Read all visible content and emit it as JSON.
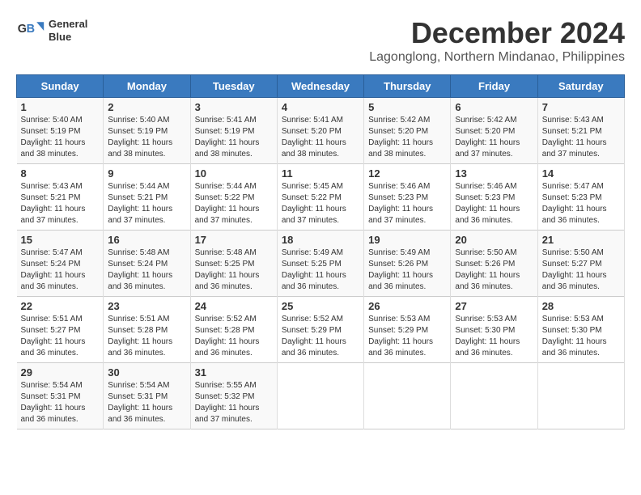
{
  "header": {
    "logo_line1": "General",
    "logo_line2": "Blue",
    "month": "December 2024",
    "location": "Lagonglong, Northern Mindanao, Philippines"
  },
  "weekdays": [
    "Sunday",
    "Monday",
    "Tuesday",
    "Wednesday",
    "Thursday",
    "Friday",
    "Saturday"
  ],
  "weeks": [
    [
      {
        "day": "1",
        "detail": "Sunrise: 5:40 AM\nSunset: 5:19 PM\nDaylight: 11 hours\nand 38 minutes."
      },
      {
        "day": "2",
        "detail": "Sunrise: 5:40 AM\nSunset: 5:19 PM\nDaylight: 11 hours\nand 38 minutes."
      },
      {
        "day": "3",
        "detail": "Sunrise: 5:41 AM\nSunset: 5:19 PM\nDaylight: 11 hours\nand 38 minutes."
      },
      {
        "day": "4",
        "detail": "Sunrise: 5:41 AM\nSunset: 5:20 PM\nDaylight: 11 hours\nand 38 minutes."
      },
      {
        "day": "5",
        "detail": "Sunrise: 5:42 AM\nSunset: 5:20 PM\nDaylight: 11 hours\nand 38 minutes."
      },
      {
        "day": "6",
        "detail": "Sunrise: 5:42 AM\nSunset: 5:20 PM\nDaylight: 11 hours\nand 37 minutes."
      },
      {
        "day": "7",
        "detail": "Sunrise: 5:43 AM\nSunset: 5:21 PM\nDaylight: 11 hours\nand 37 minutes."
      }
    ],
    [
      {
        "day": "8",
        "detail": "Sunrise: 5:43 AM\nSunset: 5:21 PM\nDaylight: 11 hours\nand 37 minutes."
      },
      {
        "day": "9",
        "detail": "Sunrise: 5:44 AM\nSunset: 5:21 PM\nDaylight: 11 hours\nand 37 minutes."
      },
      {
        "day": "10",
        "detail": "Sunrise: 5:44 AM\nSunset: 5:22 PM\nDaylight: 11 hours\nand 37 minutes."
      },
      {
        "day": "11",
        "detail": "Sunrise: 5:45 AM\nSunset: 5:22 PM\nDaylight: 11 hours\nand 37 minutes."
      },
      {
        "day": "12",
        "detail": "Sunrise: 5:46 AM\nSunset: 5:23 PM\nDaylight: 11 hours\nand 37 minutes."
      },
      {
        "day": "13",
        "detail": "Sunrise: 5:46 AM\nSunset: 5:23 PM\nDaylight: 11 hours\nand 36 minutes."
      },
      {
        "day": "14",
        "detail": "Sunrise: 5:47 AM\nSunset: 5:23 PM\nDaylight: 11 hours\nand 36 minutes."
      }
    ],
    [
      {
        "day": "15",
        "detail": "Sunrise: 5:47 AM\nSunset: 5:24 PM\nDaylight: 11 hours\nand 36 minutes."
      },
      {
        "day": "16",
        "detail": "Sunrise: 5:48 AM\nSunset: 5:24 PM\nDaylight: 11 hours\nand 36 minutes."
      },
      {
        "day": "17",
        "detail": "Sunrise: 5:48 AM\nSunset: 5:25 PM\nDaylight: 11 hours\nand 36 minutes."
      },
      {
        "day": "18",
        "detail": "Sunrise: 5:49 AM\nSunset: 5:25 PM\nDaylight: 11 hours\nand 36 minutes."
      },
      {
        "day": "19",
        "detail": "Sunrise: 5:49 AM\nSunset: 5:26 PM\nDaylight: 11 hours\nand 36 minutes."
      },
      {
        "day": "20",
        "detail": "Sunrise: 5:50 AM\nSunset: 5:26 PM\nDaylight: 11 hours\nand 36 minutes."
      },
      {
        "day": "21",
        "detail": "Sunrise: 5:50 AM\nSunset: 5:27 PM\nDaylight: 11 hours\nand 36 minutes."
      }
    ],
    [
      {
        "day": "22",
        "detail": "Sunrise: 5:51 AM\nSunset: 5:27 PM\nDaylight: 11 hours\nand 36 minutes."
      },
      {
        "day": "23",
        "detail": "Sunrise: 5:51 AM\nSunset: 5:28 PM\nDaylight: 11 hours\nand 36 minutes."
      },
      {
        "day": "24",
        "detail": "Sunrise: 5:52 AM\nSunset: 5:28 PM\nDaylight: 11 hours\nand 36 minutes."
      },
      {
        "day": "25",
        "detail": "Sunrise: 5:52 AM\nSunset: 5:29 PM\nDaylight: 11 hours\nand 36 minutes."
      },
      {
        "day": "26",
        "detail": "Sunrise: 5:53 AM\nSunset: 5:29 PM\nDaylight: 11 hours\nand 36 minutes."
      },
      {
        "day": "27",
        "detail": "Sunrise: 5:53 AM\nSunset: 5:30 PM\nDaylight: 11 hours\nand 36 minutes."
      },
      {
        "day": "28",
        "detail": "Sunrise: 5:53 AM\nSunset: 5:30 PM\nDaylight: 11 hours\nand 36 minutes."
      }
    ],
    [
      {
        "day": "29",
        "detail": "Sunrise: 5:54 AM\nSunset: 5:31 PM\nDaylight: 11 hours\nand 36 minutes."
      },
      {
        "day": "30",
        "detail": "Sunrise: 5:54 AM\nSunset: 5:31 PM\nDaylight: 11 hours\nand 36 minutes."
      },
      {
        "day": "31",
        "detail": "Sunrise: 5:55 AM\nSunset: 5:32 PM\nDaylight: 11 hours\nand 37 minutes."
      },
      {
        "day": "",
        "detail": ""
      },
      {
        "day": "",
        "detail": ""
      },
      {
        "day": "",
        "detail": ""
      },
      {
        "day": "",
        "detail": ""
      }
    ]
  ]
}
